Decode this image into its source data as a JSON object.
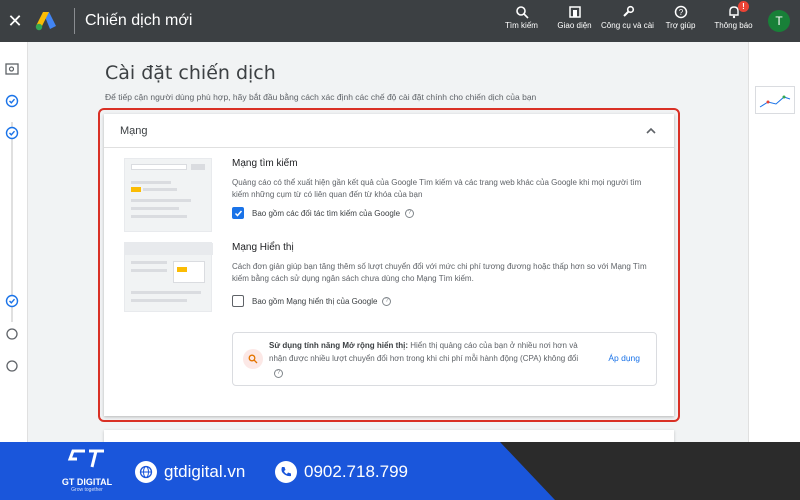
{
  "header": {
    "title": "Chiến dịch mới",
    "tools": [
      {
        "label": "Tìm kiếm",
        "icon": "search-icon"
      },
      {
        "label": "Giao diện",
        "icon": "appearance-icon"
      },
      {
        "label": "Công cụ và cài",
        "icon": "wrench-icon"
      },
      {
        "label": "Trợ giúp",
        "icon": "help-icon"
      },
      {
        "label": "Thông báo",
        "icon": "bell-icon"
      }
    ],
    "notification_badge": "!",
    "avatar_initial": "T"
  },
  "page": {
    "title": "Cài đặt chiến dịch",
    "subtitle": "Để tiếp cận người dùng phù hợp, hãy bắt đầu bằng cách xác định các chế độ cài đặt chính cho chiến dịch của bạn"
  },
  "network_card": {
    "title": "Mạng",
    "search_network": {
      "title": "Mạng tìm kiếm",
      "description": "Quảng cáo có thể xuất hiện gần kết quả của Google Tìm kiếm và các trang web khác của Google khi mọi người tìm kiếm những cụm từ có liên quan đến từ khóa của bạn",
      "checkbox_label": "Bao gồm các đối tác tìm kiếm của Google",
      "checked": true
    },
    "display_network": {
      "title": "Mạng Hiển thị",
      "description": "Cách đơn giản giúp bạn tăng thêm số lượt chuyển đổi với mức chi phí tương đương hoặc thấp hơn so với Mạng Tìm kiếm bằng cách sử dụng ngân sách chưa dùng cho Mạng Tìm kiếm.",
      "checkbox_label": "Bao gồm Mạng hiển thị của Google",
      "checked": false
    },
    "expansion": {
      "bold": "Sử dụng tính năng Mở rộng hiển thị:",
      "text": " Hiển thị quảng cáo của bạn ở nhiều nơi hơn và nhận được nhiều lượt chuyển đổi hơn trong khi chi phí mỗi hành động (CPA) không đổi",
      "action": "Áp dụng"
    }
  },
  "footer": {
    "brand_name": "GT DIGITAL",
    "brand_tagline": "Grow together",
    "website": "gtdigital.vn",
    "phone": "0902.718.799"
  },
  "colors": {
    "topbar": "#3c4043",
    "accent": "#1a73e8",
    "highlight": "#d93025",
    "footer_blue": "#1a56db",
    "footer_dark": "#2b2b2b"
  }
}
